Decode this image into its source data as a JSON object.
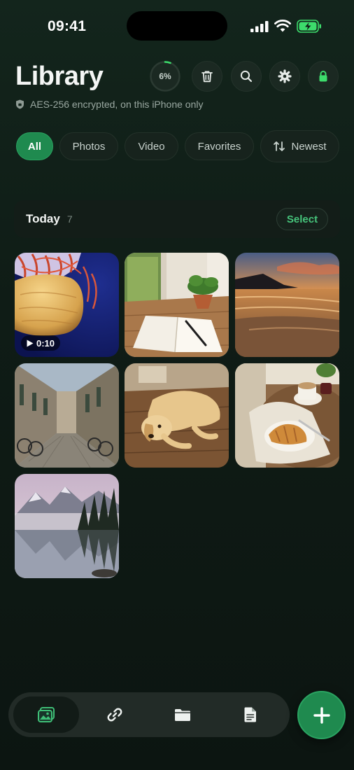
{
  "status_bar": {
    "time": "09:41",
    "icons": [
      "cellular-signal-icon",
      "wifi-icon",
      "battery-charging-icon"
    ]
  },
  "header": {
    "title": "Library",
    "subtitle": "AES-256 encrypted, on this iPhone only",
    "subtitle_icon": "shield-icon",
    "progress": {
      "label": "6%",
      "value": 0.06
    },
    "buttons": [
      "trash-icon",
      "search-icon",
      "gear-icon",
      "lock-icon"
    ]
  },
  "filters": {
    "items": [
      "All",
      "Photos",
      "Video",
      "Favorites"
    ],
    "active": "All",
    "sort": {
      "label": "Newest",
      "icon": "sort-arrows-icon"
    }
  },
  "section": {
    "title": "Today",
    "count": "7",
    "select_label": "Select"
  },
  "grid": [
    {
      "name": "jellyfish",
      "type": "video",
      "duration": "0:10"
    },
    {
      "name": "notebook-and-plant",
      "type": "photo"
    },
    {
      "name": "beach-sunset",
      "type": "photo"
    },
    {
      "name": "cobblestone-street",
      "type": "photo"
    },
    {
      "name": "golden-retriever",
      "type": "photo"
    },
    {
      "name": "coffee-and-croissant",
      "type": "photo"
    },
    {
      "name": "misty-mountain-lake",
      "type": "photo"
    }
  ],
  "tabbar": {
    "tabs": [
      "photos-icon",
      "link-icon",
      "folder-icon",
      "document-icon"
    ],
    "active": "photos-icon",
    "fab": "plus-icon"
  },
  "colors": {
    "accent": "#1f8a4f",
    "accent_text": "#46c47b",
    "background": "#0f1c16"
  }
}
